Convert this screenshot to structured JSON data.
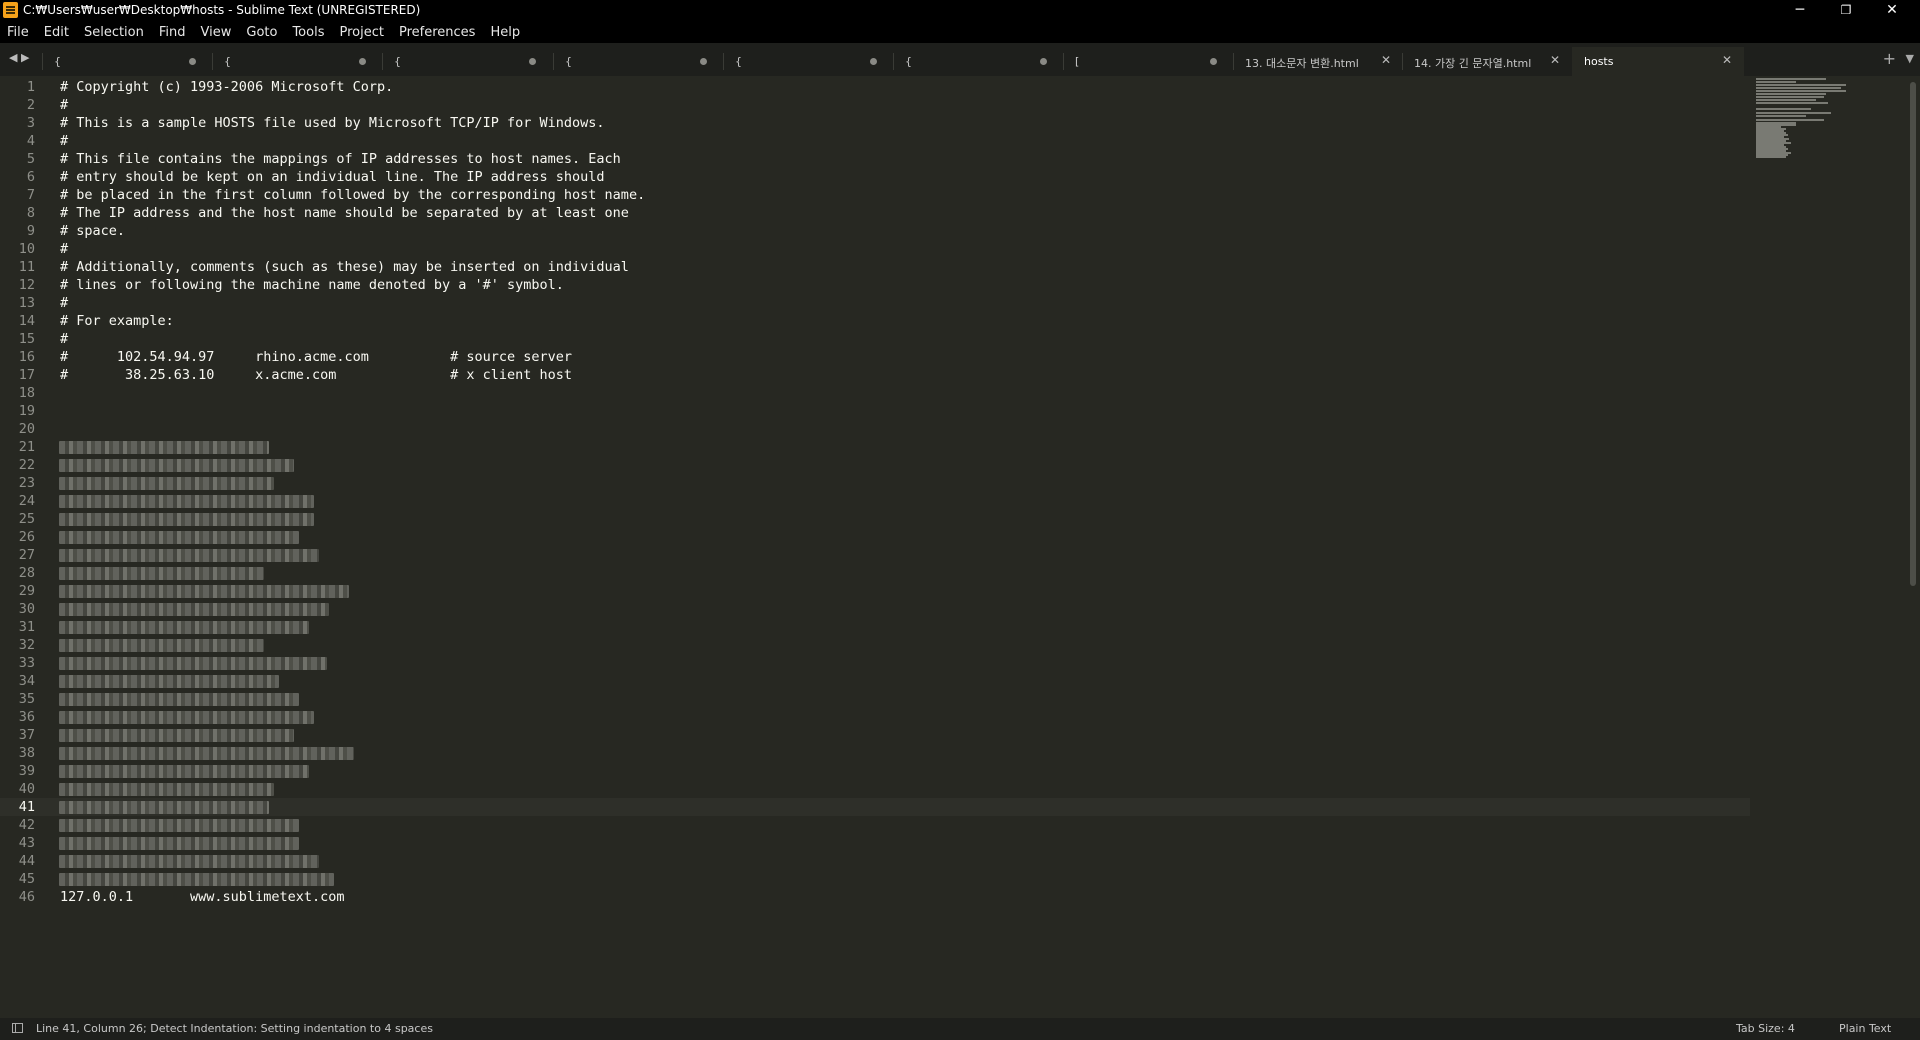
{
  "window": {
    "title": "C:₩Users₩user₩Desktop₩hosts - Sublime Text (UNREGISTERED)",
    "minimize": "─",
    "maximize": "❐",
    "close": "✕"
  },
  "menu": [
    "File",
    "Edit",
    "Selection",
    "Find",
    "View",
    "Goto",
    "Tools",
    "Project",
    "Preferences",
    "Help"
  ],
  "tabs": [
    {
      "label": "{",
      "modified": true
    },
    {
      "label": "{",
      "modified": true
    },
    {
      "label": "{",
      "modified": true
    },
    {
      "label": "{",
      "modified": true
    },
    {
      "label": "{",
      "modified": true
    },
    {
      "label": "{",
      "modified": true
    },
    {
      "label": "[",
      "modified": true
    },
    {
      "label": "13. 대소문자 변환.html",
      "modified": false
    },
    {
      "label": "14. 가장 긴 문자열.html",
      "modified": false
    },
    {
      "label": "hosts",
      "modified": false,
      "active": true
    }
  ],
  "tab_controls": {
    "left": "◀ ▶",
    "plus": "+",
    "menu": "▼",
    "close": "✕"
  },
  "editor": {
    "current_line": 41,
    "lines": [
      "# Copyright (c) 1993-2006 Microsoft Corp.",
      "#",
      "# This is a sample HOSTS file used by Microsoft TCP/IP for Windows.",
      "#",
      "# This file contains the mappings of IP addresses to host names. Each",
      "# entry should be kept on an individual line. The IP address should",
      "# be placed in the first column followed by the corresponding host name.",
      "# The IP address and the host name should be separated by at least one",
      "# space.",
      "#",
      "# Additionally, comments (such as these) may be inserted on individual",
      "# lines or following the machine name denoted by a '#' symbol.",
      "#",
      "# For example:",
      "#",
      "#      102.54.94.97     rhino.acme.com          # source server",
      "#       38.25.63.10     x.acme.com              # x client host",
      "",
      "",
      "",
      null,
      null,
      null,
      null,
      null,
      null,
      null,
      null,
      null,
      null,
      null,
      null,
      null,
      null,
      null,
      null,
      null,
      null,
      null,
      null,
      null,
      null,
      null,
      null,
      null,
      "127.0.0.1       www.sublimetext.com"
    ],
    "redacted_widths": [
      210,
      235,
      215,
      255,
      255,
      240,
      260,
      205,
      290,
      270,
      250,
      205,
      268,
      220,
      240,
      255,
      235,
      295,
      250,
      215,
      210,
      240,
      240,
      260,
      275
    ]
  },
  "status": {
    "message": "Line 41, Column 26; Detect Indentation: Setting indentation to 4 spaces",
    "tab_size": "Tab Size: 4",
    "syntax": "Plain Text"
  },
  "colors": {
    "background": "#272822",
    "foreground": "#f8f8f2",
    "gutter": "#8f908a",
    "chrome": "#1e1f1c"
  }
}
